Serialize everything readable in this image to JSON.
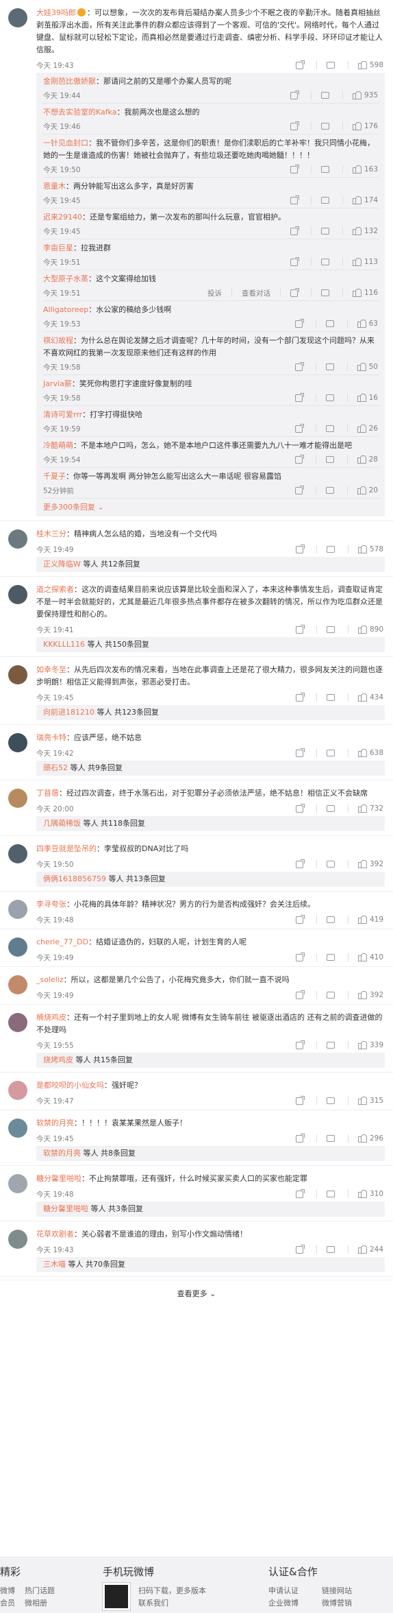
{
  "c1": {
    "name": "大娃39吗郎",
    "badge": "vip",
    "text": "：可以想象，一次次的发布背后凝结办案人员多少个不眠之夜的辛勤汗水。随着真相抽丝剥茧般浮出水面，所有关注此事件的群众都应该得到了一个客观、可信的'交代'。网络时代，每个人通过键盘、鼠标就可以轻松下定论，而真相必然是要通过行走调查、缜密分析、科学手段、环环印证才能让人信服。",
    "time": "今天 19:43",
    "likes": "598"
  },
  "subs": [
    {
      "name": "金刚芭比傲娇獸",
      "text": "：那请问之前的又是哪个办案人员写的呢",
      "time": "今天 19:44",
      "likes": "935"
    },
    {
      "name": "不想去实验室的Kafka",
      "text": "：我前两次也是这么想的",
      "time": "今天 19:46",
      "likes": "176"
    },
    {
      "name": "一针见血封口",
      "text": "：我不管你们多辛苦，这是你们的职责！是你们渎职后的亡羊补牢！我只同情小花梅，她的一生是谁造成的伤害！她被社会抛弃了，有些垃圾还要吃她肉喝她髓！！！！",
      "time": "今天 19:50",
      "likes": "163"
    },
    {
      "name": "恩童木",
      "text": "：两分钟能写出这么多字，真是好厉害",
      "time": "今天 19:45",
      "likes": "174"
    },
    {
      "name": "迟来29140",
      "text": "：还是专案组给力，第一次发布的那叫什么玩意，官官相护。",
      "time": "今天 19:45",
      "likes": "132"
    },
    {
      "name": "李亩巨星",
      "text": "：拉我进群",
      "time": "今天 19:51",
      "likes": "113"
    },
    {
      "name": "大型原子水蒸",
      "text": "：这个文案得给加钱",
      "time": "今天 19:51",
      "likes": "116",
      "extra": [
        "投诉",
        "查看对话"
      ]
    },
    {
      "name": "Alligatoreep",
      "text": "：水公家的稿给多少钱啊",
      "time": "今天 19:53",
      "likes": "63"
    },
    {
      "name": "祺幻故程",
      "text": "：为什么总在舆论发酵之后才调查呢？几十年的时间，没有一个部门发现这个问题吗？从来不喜欢网红的我第一次发现原来他们还有这样的作用",
      "time": "今天 19:58",
      "likes": "50"
    },
    {
      "name": "Jarvia薪",
      "text": "：笑死你构思打字速度好像复制的哇",
      "time": "今天 19:58",
      "likes": "16"
    },
    {
      "name": "清诗可爱rrr",
      "text": "：打字打得挺快哈",
      "time": "今天 19:59",
      "likes": "26"
    },
    {
      "name": "冷酷萌萌",
      "text": "：不是本地户口吗，怎么，她不是本地户口这件事还需要九九八十一难才能得出是吧",
      "time": "今天 19:54",
      "likes": "28"
    },
    {
      "name": "千夏子",
      "text": "：你等一等再发啊 两分钟怎么能写出这么大一串话呢 很容易露馅",
      "time": "52分钟前",
      "likes": "20"
    }
  ],
  "more_sub": "更多300条回复",
  "comments": [
    {
      "name": "桂木三分",
      "text": "：精神病人怎么结的婚，当地没有一个交代吗",
      "time": "今天 19:49",
      "likes": "578",
      "rep_name": "正义降临W",
      "rep_text": "等人 共12条回复"
    },
    {
      "name": "道之探索者",
      "text": "：这次的调查结果目前来说应该算是比较全面和深入了，本来这种事情发生后，调查取证肯定不是一时半会就能好的，尤其是最近几年很多热点事件都存在被多次翻转的情况，所以作为吃瓜群众还是要保持理性和耐心的。",
      "time": "今天 19:41",
      "likes": "890",
      "rep_name": "KKKLLL116",
      "rep_text": "等人 共150条回复"
    },
    {
      "name": "如幸冬至",
      "text": "：从先后四次发布的情况来看，当地在此事调查上还是花了很大精力，很多网友关注的问题也逐步明朗！相信正义能得到声张，邪恶必受打击。",
      "time": "今天 19:45",
      "likes": "434",
      "rep_name": "向前进181210",
      "rep_text": "等人 共123条回复"
    },
    {
      "name": "瑞亮卡特",
      "text": "：应该严惩，绝不姑息",
      "time": "今天 19:42",
      "likes": "638",
      "rep_name": "頭石52",
      "rep_text": "等人 共9条回复"
    },
    {
      "name": "丁苜蓿",
      "text": "：经过四次调查，终于水落石出，对于犯罪分子必须依法严惩，绝不姑息！相信正义不会缺席",
      "time": "今天 20:00",
      "likes": "732",
      "rep_name": "几隅蔺稀饭",
      "rep_text": "等人 共118条回复"
    },
    {
      "name": "四季豆就是坠吊的",
      "text": "：李莹叔叔的DNA对比了吗",
      "time": "今天 19:50",
      "likes": "392",
      "rep_name": "俩俩1618856759",
      "rep_text": "等人 共13条回复"
    },
    {
      "name": "李寻夸张",
      "text": "：小花梅的具体年龄？精神状况？男方的行为是否构成强奸？会关注后续。",
      "time": "今天 19:48",
      "likes": "419"
    },
    {
      "name": "cherie_77_DD",
      "text": "：结婚证造伪的，妇联的人呢，计划生育的人呢",
      "time": "今天 19:49",
      "likes": "410"
    },
    {
      "name": "_soleliz",
      "text": "：所以，这都是第几个公告了，小花梅究竟多大，你们就一直不说吗",
      "time": "今天 19:49",
      "likes": "392"
    },
    {
      "name": "楠烧鸡皮",
      "text": "：还有一个村子里到地上的女人呢 微博有女生骑车前往 被驱逐出酒店的 还有之前的调查进做的 不处理吗",
      "time": "今天 19:55",
      "likes": "339",
      "rep_name": "烧烤鸡皮",
      "rep_text": "等人 共15条回复"
    },
    {
      "name": "是都咬呗的小仙女吗",
      "text": "：强奸呢？",
      "time": "今天 19:47",
      "likes": "315"
    },
    {
      "name": "软禁的月亮",
      "text": "：！！！！袁某某果然是人贩子！",
      "time": "今天 19:45",
      "likes": "296",
      "rep_name": "软禁的月亮",
      "rep_text": "等人 共8条回复"
    },
    {
      "name": "糖分馨里啪啦",
      "text": "：不止拘禁罪哦，还有强奸，什么时候买家买卖人口的买家也能定罪",
      "time": "今天 19:48",
      "likes": "310",
      "rep_name": "糖分馨里啪啦",
      "rep_text": "等人 共3条回复"
    },
    {
      "name": "花草欢剧者",
      "text": "：关心弱者不是谁追的理由，别写小作文煽动情绪！",
      "time": "今天 19:43",
      "likes": "244",
      "rep_name": "三木喵",
      "rep_text": "等人 共70条回复"
    }
  ],
  "actions": {
    "share": "",
    "comment": ""
  },
  "load_more": "查看更多",
  "footer": {
    "col1_title": "精彩",
    "col1_items": [
      "微博",
      "热门话题",
      "会员",
      "微相册"
    ],
    "col2_title": "手机玩微博",
    "col2_items": [
      "扫码下载，更多版本",
      "联系我们"
    ],
    "col3_title": "认证&合作",
    "col3_items": [
      "申请认证",
      "链接网站",
      "企业微博",
      "微博营销"
    ]
  }
}
